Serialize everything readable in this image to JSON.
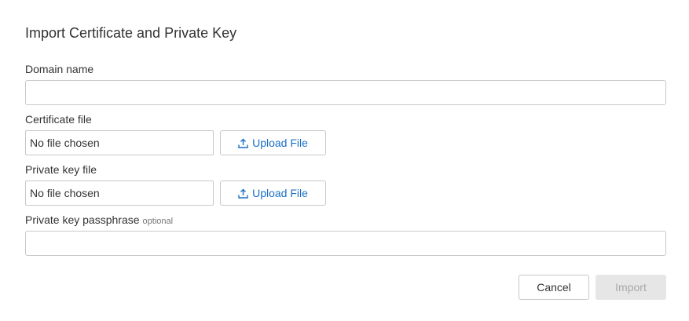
{
  "dialog": {
    "title": "Import Certificate and Private Key"
  },
  "domain": {
    "label": "Domain name",
    "value": "",
    "placeholder": ""
  },
  "certificate": {
    "label": "Certificate file",
    "file_status": "No file chosen",
    "upload_label": "Upload File",
    "upload_icon": "upload-icon"
  },
  "private_key": {
    "label": "Private key file",
    "file_status": "No file chosen",
    "upload_label": "Upload File",
    "upload_icon": "upload-icon"
  },
  "passphrase": {
    "label": "Private key passphrase",
    "optional_tag": "optional",
    "value": "",
    "placeholder": ""
  },
  "actions": {
    "cancel_label": "Cancel",
    "import_label": "Import",
    "import_enabled": false
  },
  "colors": {
    "link_blue": "#1a6fc4",
    "border": "#c8c8c8",
    "disabled_bg": "#e6e6e6",
    "disabled_text": "#a8a8a8"
  }
}
